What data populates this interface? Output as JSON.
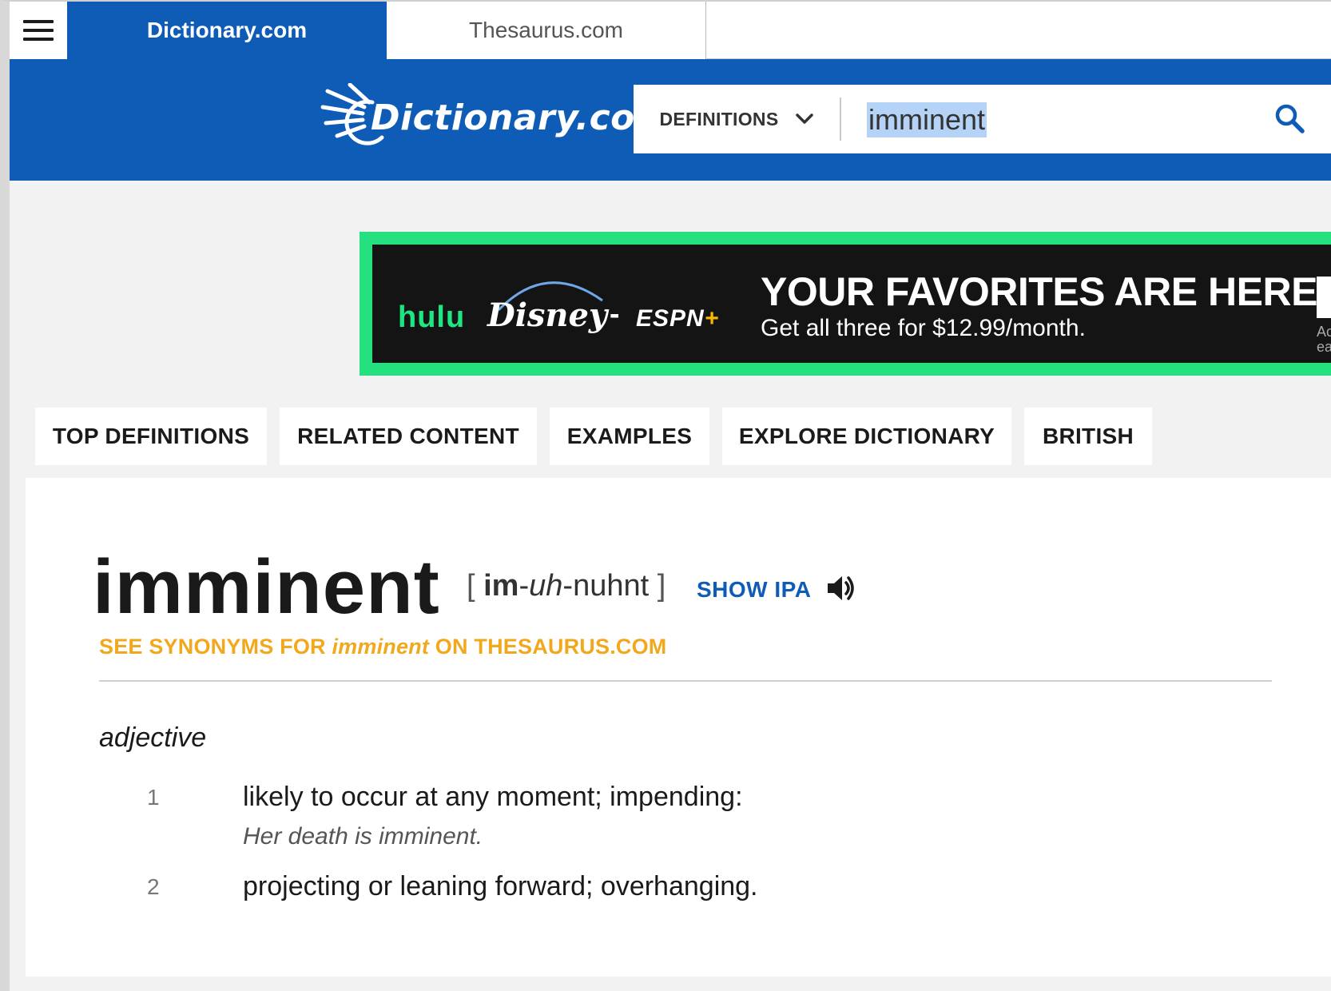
{
  "top_tabs": {
    "dictionary": "Dictionary.com",
    "thesaurus": "Thesaurus.com"
  },
  "header": {
    "logo_text": "Dictionary.com",
    "search_mode": "DEFINITIONS",
    "search_value": "imminent"
  },
  "ad": {
    "brand_1": "hulu",
    "brand_2": "Disney+",
    "brand_3": "ESPN",
    "brand_3_plus": "+",
    "headline": "YOUR FAVORITES ARE HERE.",
    "subline": "Get all three for $12.99/month.",
    "fine_print": "Acc eac"
  },
  "section_nav": [
    "TOP DEFINITIONS",
    "RELATED CONTENT",
    "EXAMPLES",
    "EXPLORE DICTIONARY",
    "BRITISH"
  ],
  "entry": {
    "headword": "imminent",
    "pron_open": "[ ",
    "pron_syl1": "im",
    "pron_sep1": "-",
    "pron_syl2": "uh",
    "pron_sep2": "-",
    "pron_syl3": "nuhnt",
    "pron_close": " ]",
    "show_ipa": "SHOW IPA",
    "synonyms_pre": "SEE SYNONYMS FOR ",
    "synonyms_word": "imminent",
    "synonyms_post": " ON THESAURUS.COM",
    "part_of_speech": "adjective",
    "definitions": [
      {
        "num": "1",
        "text": "likely to occur at any moment; impending:",
        "example": "Her death is imminent."
      },
      {
        "num": "2",
        "text": "projecting or leaning forward; overhanging.",
        "example": ""
      }
    ]
  },
  "colors": {
    "brand_blue": "#0f5cb7",
    "synonym_orange": "#f2a81d",
    "ad_green": "#24e07e",
    "selection": "#b4d3f6"
  }
}
